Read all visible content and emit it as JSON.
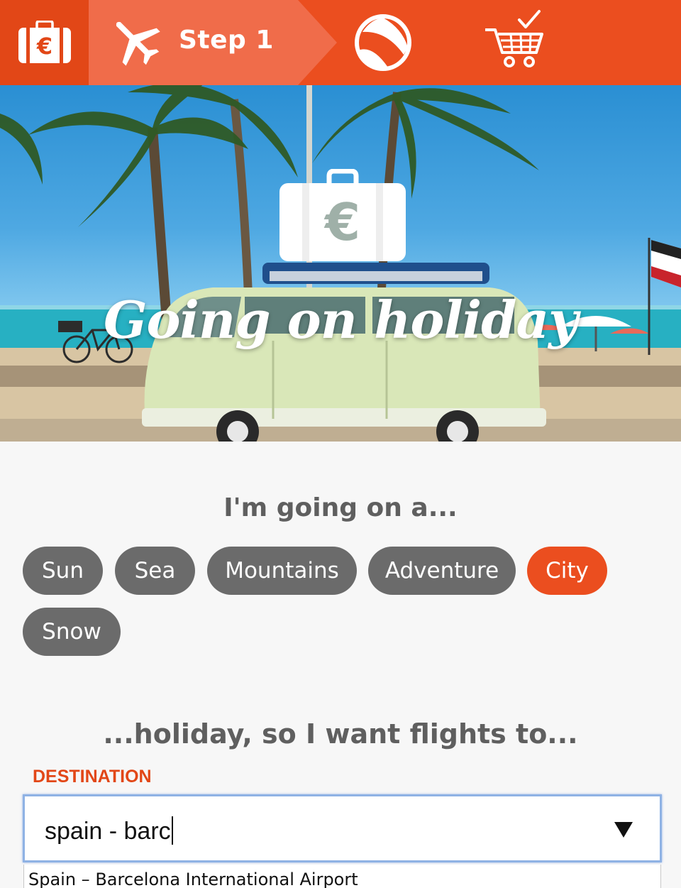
{
  "topbar": {
    "step_label": "Step 1",
    "icons": [
      "euro-suitcase-icon",
      "plane-icon",
      "beach-ball-icon",
      "cart-check-icon"
    ],
    "colors": {
      "primary": "#eb4e1f",
      "active_step": "#f06c4a"
    }
  },
  "hero": {
    "title": "Going on holiday",
    "logo_icon": "euro-suitcase-icon"
  },
  "holiday_type": {
    "question": "I'm going on a...",
    "options": [
      {
        "label": "Sun",
        "selected": false
      },
      {
        "label": "Sea",
        "selected": false
      },
      {
        "label": "Mountains",
        "selected": false
      },
      {
        "label": "Adventure",
        "selected": false
      },
      {
        "label": "City",
        "selected": true
      },
      {
        "label": "Snow",
        "selected": false
      }
    ]
  },
  "destination": {
    "question": "...holiday, so I want flights to...",
    "label": "DESTINATION",
    "value": "spain - barc",
    "suggestions": [
      "Spain – Barcelona International Airport"
    ]
  }
}
